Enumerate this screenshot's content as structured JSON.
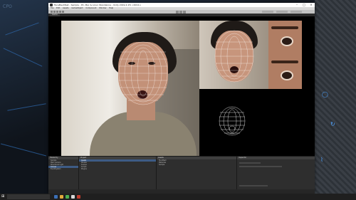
{
  "window": {
    "title": "FaceMeshTest - Sample - PC, Mac & Linux Standalone - Unity 2019.4.1f1 <DX11>",
    "minimize_icon": "minimize-icon",
    "maximize_icon": "maximize-icon",
    "close_icon": "close-icon"
  },
  "menubar": [
    "File",
    "Edit",
    "Assets",
    "GameObject",
    "Component",
    "Window",
    "Help"
  ],
  "game_view": {
    "tab_label": "Game"
  },
  "panels": {
    "hierarchy": {
      "header": "Hierarchy",
      "rows": [
        "Sample",
        "Main Camera",
        "Directional Light",
        "Canvas",
        "EventSystem"
      ]
    },
    "project": {
      "header": "Project",
      "rows": [
        "Assets",
        "Models",
        "Scenes",
        "Scripts",
        "Plugins"
      ]
    },
    "assets": {
      "header": "Assets",
      "rows": [
        "FaceMesh",
        "Materials",
        "Sample"
      ]
    },
    "inspector": {
      "header": "Inspector"
    }
  },
  "statusbar": {
    "text": ""
  },
  "colors": {
    "accent": "#3d5b85",
    "taskbar": "#1f1f1f",
    "window_title_bg": "#ffffff"
  }
}
